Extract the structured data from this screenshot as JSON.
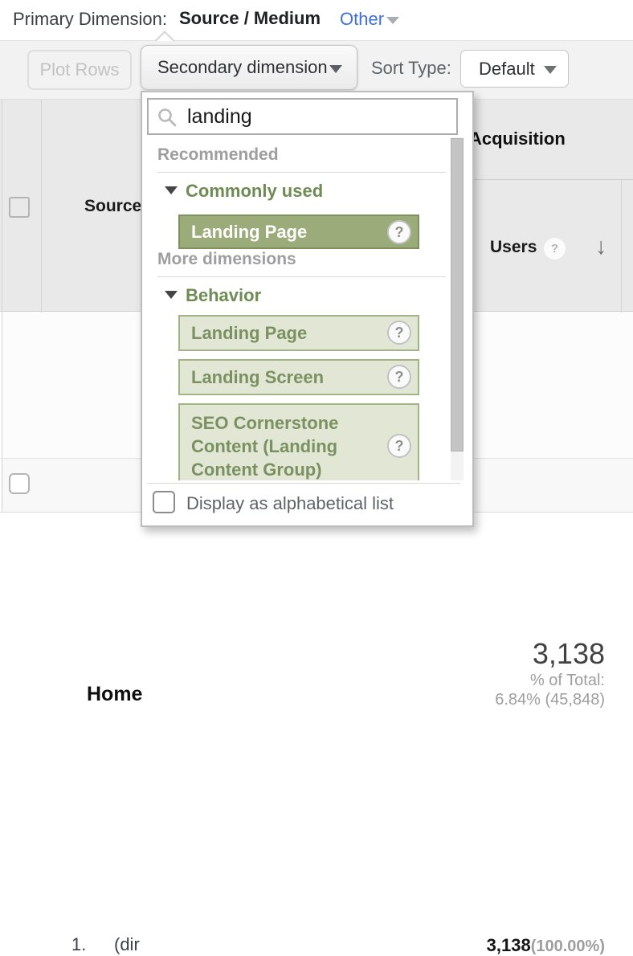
{
  "primary_dimension": {
    "label": "Primary Dimension:",
    "selected": "Source / Medium",
    "other": "Other"
  },
  "toolbar": {
    "plot_rows": "Plot Rows",
    "secondary_dimension": "Secondary dimension",
    "sort_type_label": "Sort Type:",
    "sort_type_value": "Default"
  },
  "dropdown": {
    "search_value": "landing",
    "groups": [
      {
        "title": "Recommended",
        "category": "Commonly used",
        "items": [
          {
            "label": "Landing Page",
            "state": "selected"
          }
        ]
      },
      {
        "title": "More dimensions",
        "category": "Behavior",
        "items": [
          {
            "label": "Landing Page"
          },
          {
            "label": "Landing Screen"
          },
          {
            "label": "SEO Cornerstone Content (Landing Content Group)"
          }
        ]
      }
    ],
    "footer_checkbox_label": "Display as alphabetical list"
  },
  "table": {
    "headers": {
      "source": "Source",
      "acquisition": "Acquisition",
      "users": "Users"
    },
    "summary": {
      "segment": "Home",
      "users_value": "3,138",
      "percent_of_total_label": "% of Total:",
      "percent_of_total_value": "6.84% (45,848)"
    },
    "rows": [
      {
        "index": "1.",
        "source_visible": "(dir",
        "users": "3,138",
        "users_percent": "(100.00%)"
      }
    ]
  },
  "icons": {
    "help": "?",
    "sort_descending": "↓"
  },
  "colors": {
    "link_blue": "#3e6fe0",
    "selected_item_bg": "#9cab7a",
    "selected_item_border": "#7e905b",
    "item_bg": "#e2e7d5",
    "item_border": "#a4b385",
    "item_text": "#7b9161",
    "section_green": "#6e8c52",
    "muted_heading": "#9e9e9e",
    "toolbar_bg": "#f2f2f2",
    "table_header_bg": "#e9e9e9"
  }
}
